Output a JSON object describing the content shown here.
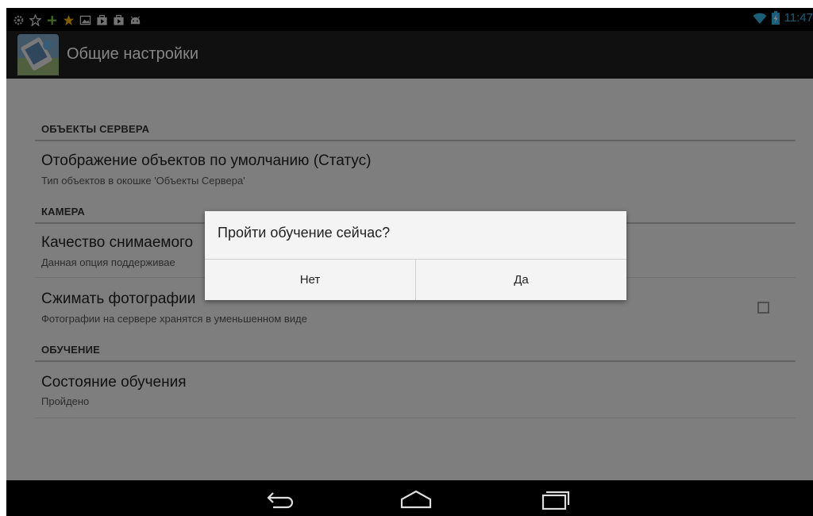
{
  "status_bar": {
    "notification_icons": [
      "gear-icon",
      "star-outline-icon",
      "plus-icon",
      "star-icon",
      "image-icon",
      "briefcase-play-icon",
      "briefcase-play-icon",
      "android-icon"
    ],
    "time": "11:47",
    "status_icons": [
      "wifi-icon",
      "battery-charging-icon"
    ]
  },
  "action_bar": {
    "title": "Общие настройки"
  },
  "preferences": {
    "server_objects": {
      "header": "ОБЪЕКТЫ СЕРВЕРА",
      "items": [
        {
          "title": "Отображение объектов по умолчанию (Статус)",
          "summary": "Тип объектов в окошке 'Объекты Сервера'"
        }
      ]
    },
    "camera": {
      "header": "КАМЕРА",
      "items": [
        {
          "title": "Качество снимаемого",
          "summary": "Данная опция поддерживае"
        },
        {
          "title": "Сжимать фотографии",
          "summary": "Фотографии на сервере хранятся в уменьшенном виде",
          "checked": false
        }
      ]
    },
    "training": {
      "header": "ОБУЧЕНИЕ",
      "items": [
        {
          "title": "Состояние обучения",
          "summary": "Пройдено"
        }
      ]
    }
  },
  "dialog": {
    "message": "Пройти обучение сейчас?",
    "negative_label": "Нет",
    "positive_label": "Да"
  },
  "nav_bar": {
    "buttons": [
      "back-icon",
      "home-icon",
      "recent-apps-icon"
    ]
  },
  "colors": {
    "accent": "#33b5e5",
    "background": "#f2f2f2",
    "dim_overlay": "rgba(0,0,0,0.48)"
  }
}
